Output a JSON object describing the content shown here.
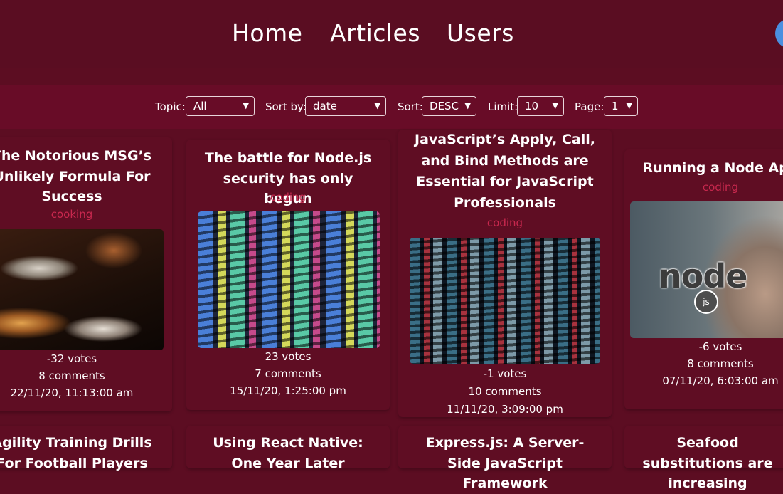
{
  "nav": {
    "links": [
      "Home",
      "Articles",
      "Users"
    ]
  },
  "filters": {
    "topic_label": "Topic:",
    "topic_value": "All",
    "sortby_label": "Sort by:",
    "sortby_value": "date",
    "sort_label": "Sort:",
    "sort_value": "DESC",
    "limit_label": "Limit:",
    "limit_value": "10",
    "page_label": "Page:",
    "page_value": "1"
  },
  "articles": [
    {
      "title": "The Notorious MSG’s Unlikely Formula For Success",
      "topic": "cooking",
      "votes": "-32 votes",
      "comments": "8 comments",
      "date": "22/11/20, 11:13:00 am"
    },
    {
      "title": "The battle for Node.js security has only begun",
      "topic": "coding",
      "votes": "23 votes",
      "comments": "7 comments",
      "date": "15/11/20, 1:25:00 pm"
    },
    {
      "title": "JavaScript’s Apply, Call, and Bind Methods are Essential for JavaScript Professionals",
      "topic": "coding",
      "votes": "-1 votes",
      "comments": "10 comments",
      "date": "11/11/20, 3:09:00 pm"
    },
    {
      "title": "Running a Node App",
      "topic": "coding",
      "votes": "-6 votes",
      "comments": "8 comments",
      "date": "07/11/20, 6:03:00 am"
    }
  ],
  "next_row_titles": [
    "Agility Training Drills For Football Players",
    "Using React Native: One Year Later",
    "Express.js: A Server-Side JavaScript Framework",
    "Seafood substitutions are increasing"
  ],
  "image_text": {
    "node_logo": "node",
    "node_js": "js"
  }
}
